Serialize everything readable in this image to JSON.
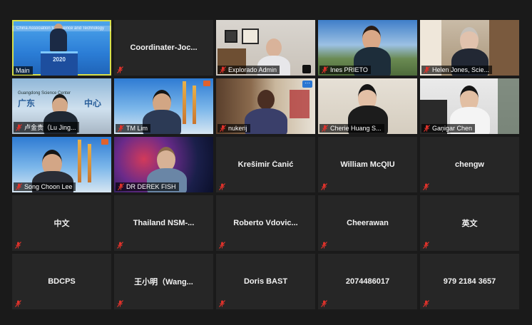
{
  "participants": [
    {
      "name": "Main",
      "video": true,
      "active": true
    },
    {
      "name": "Coordinater-Joc...",
      "video": false,
      "muted": true
    },
    {
      "name": "Explorado Admin",
      "video": true,
      "muted": true
    },
    {
      "name": "Ines PRIETO",
      "video": true,
      "muted": true
    },
    {
      "name": "Helen Jones, Scie...",
      "video": true,
      "muted": true
    },
    {
      "name": "卢金贵（Lu Jing...",
      "video": true,
      "muted": true
    },
    {
      "name": "TM Lim",
      "video": true,
      "muted": true
    },
    {
      "name": "nukerij",
      "video": true,
      "muted": true
    },
    {
      "name": "Cherie Huang S...",
      "video": true,
      "muted": true
    },
    {
      "name": "Gaņigar Chen",
      "video": true,
      "muted": true
    },
    {
      "name": "Song Choon Lee",
      "video": true,
      "muted": true
    },
    {
      "name": "DR DEREK FISH",
      "video": true,
      "muted": true
    },
    {
      "name": "Krešimir Čanić",
      "video": false,
      "muted": true
    },
    {
      "name": "William McQIU",
      "video": false,
      "muted": true
    },
    {
      "name": "chengw",
      "video": false,
      "muted": true
    },
    {
      "name": "中文",
      "video": false,
      "muted": true
    },
    {
      "name": "Thailand  NSM-...",
      "video": false,
      "muted": true
    },
    {
      "name": "Roberto  Vdovic...",
      "video": false,
      "muted": true
    },
    {
      "name": "Cheerawan",
      "video": false,
      "muted": true
    },
    {
      "name": "英文",
      "video": false,
      "muted": true
    },
    {
      "name": "BDCPS",
      "video": false,
      "muted": true
    },
    {
      "name": "王小明（Wang...",
      "video": false,
      "muted": true
    },
    {
      "name": "Doris BAST",
      "video": false,
      "muted": true
    },
    {
      "name": "2074486017",
      "video": false,
      "muted": true
    },
    {
      "name": "979 2184 3657",
      "video": false,
      "muted": true
    }
  ],
  "colors": {
    "background": "#1a1a1a",
    "tile": "#262626",
    "active_border": "#d8e04a",
    "muted_icon": "#e0322b"
  },
  "icons": {
    "muted": "mic-muted-icon"
  },
  "video_texts": {
    "main_banner": "China Association for Science and Technology",
    "main_year": "2020",
    "center_sign_cn": "广东",
    "center_sign_cn2": "中心",
    "center_sign_en": "Guangdong Science Center"
  }
}
